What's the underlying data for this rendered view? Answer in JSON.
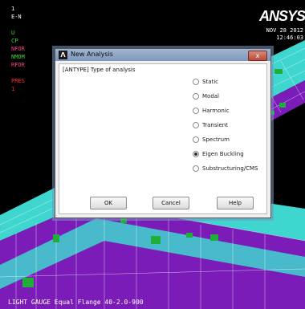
{
  "legend": [
    {
      "text": "1",
      "color": "#ffffff"
    },
    {
      "text": "E-N",
      "color": "#ffffff"
    },
    {
      "text": "",
      "color": "#ffffff"
    },
    {
      "text": "U",
      "color": "#4ccf3a"
    },
    {
      "text": "CP",
      "color": "#4ccf3a"
    },
    {
      "text": "NFOR",
      "color": "#ff3b8c"
    },
    {
      "text": "NMOM",
      "color": "#4ccf3a"
    },
    {
      "text": "RFOR",
      "color": "#ff3b8c"
    },
    {
      "text": "",
      "color": "#ffffff"
    },
    {
      "text": "PRES",
      "color": "#ff2a2a"
    },
    {
      "text": "1",
      "color": "#ff2a2a"
    }
  ],
  "logo": "ANSYS",
  "datetime": [
    "NOV 28 2012",
    "12:46:03"
  ],
  "caption": "LIGHT GAUGE Equal Flange 40-2.0-900",
  "dialog": {
    "title": "New Analysis",
    "title_icon": "Λ",
    "close_symbol": "x",
    "prompt": "[ANTYPE]  Type of analysis",
    "options": [
      {
        "label": "Static",
        "selected": false
      },
      {
        "label": "Modal",
        "selected": false
      },
      {
        "label": "Harmonic",
        "selected": false
      },
      {
        "label": "Transient",
        "selected": false
      },
      {
        "label": "Spectrum",
        "selected": false
      },
      {
        "label": "Eigen Buckling",
        "selected": true
      },
      {
        "label": "Substructuring/CMS",
        "selected": false
      }
    ],
    "buttons": {
      "ok": "OK",
      "cancel": "Cancel",
      "help": "Help"
    }
  },
  "colors": {
    "beam_flange": "#3fd6cf",
    "beam_web": "#8a1fc6",
    "background": "#000000",
    "constraint": "#1fae3a"
  }
}
